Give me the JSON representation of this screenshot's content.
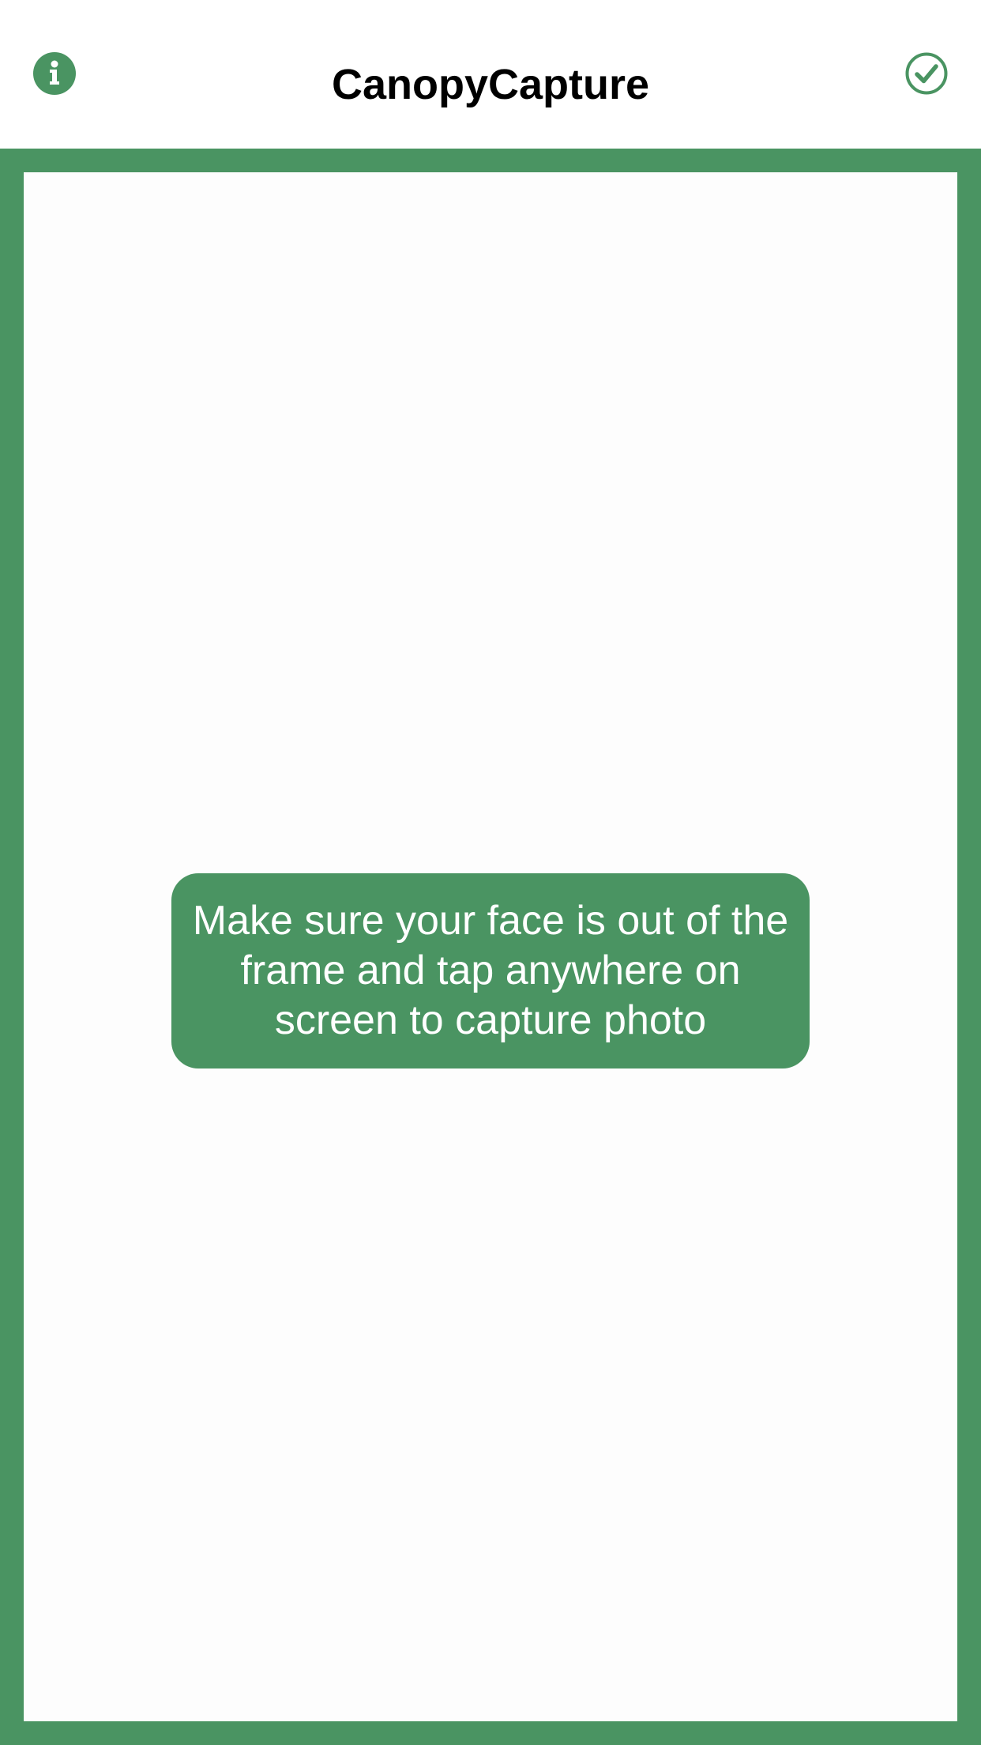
{
  "header": {
    "title": "CanopyCapture",
    "info_icon": "info-icon",
    "done_icon": "check-circle-icon"
  },
  "camera": {
    "hint": "Make sure your face is out of the frame and tap anywhere on screen to capture photo"
  },
  "colors": {
    "accent": "#4a9462",
    "background": "#ffffff",
    "title": "#000000",
    "hint_text": "#ffffff"
  }
}
